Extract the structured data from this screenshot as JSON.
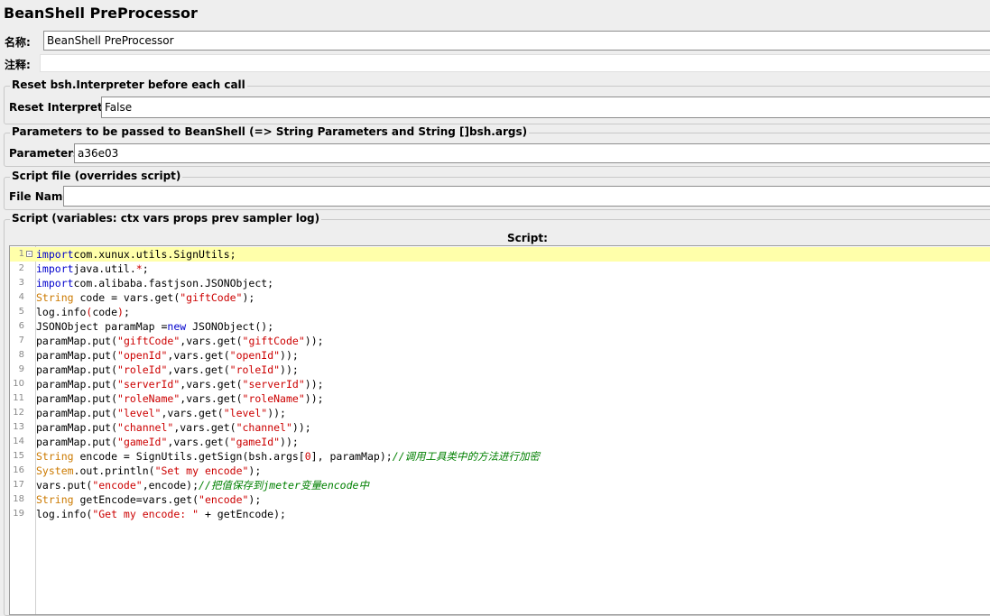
{
  "title": "BeanShell PreProcessor",
  "name": {
    "label": "名称:",
    "value": "BeanShell PreProcessor"
  },
  "comment": {
    "label": "注释:",
    "value": ""
  },
  "reset_group": {
    "legend": "Reset bsh.Interpreter before each call",
    "label": "Reset Interpreter:",
    "value": "False"
  },
  "params_group": {
    "legend": "Parameters to be passed to BeanShell (=> String Parameters and String []bsh.args)",
    "label": "Parameters:",
    "value": "a36e03"
  },
  "file_group": {
    "legend": "Script file (overrides script)",
    "label": "File Name:",
    "value": ""
  },
  "script_group": {
    "legend": "Script (variables: ctx vars props prev sampler log)",
    "label": "Script:"
  },
  "colors": {
    "keyword": "#0000cc",
    "type": "#cc7a00",
    "string": "#cc0000",
    "comment": "#008000",
    "current_line": "#ffffaa"
  },
  "script_lines": [
    {
      "n": "1",
      "tokens": [
        [
          "kw",
          "import"
        ],
        [
          "",
          "com.xunux.utils.SignUtils;"
        ]
      ]
    },
    {
      "n": "2",
      "tokens": [
        [
          "kw",
          "import"
        ],
        [
          "",
          "java.util."
        ],
        [
          "pn",
          "*"
        ],
        [
          "",
          ";"
        ]
      ]
    },
    {
      "n": "3",
      "tokens": [
        [
          "kw",
          "import"
        ],
        [
          "",
          "com.alibaba.fastjson.JSONObject;"
        ]
      ]
    },
    {
      "n": "4",
      "tokens": [
        [
          "ty",
          "String"
        ],
        [
          "",
          " code = vars.get("
        ],
        [
          "st",
          "\"giftCode\""
        ],
        [
          "",
          ");"
        ]
      ]
    },
    {
      "n": "5",
      "tokens": [
        [
          "",
          "log.info"
        ],
        [
          "pn",
          "("
        ],
        [
          "",
          "code"
        ],
        [
          "pn",
          ")"
        ],
        [
          "",
          ";"
        ]
      ]
    },
    {
      "n": "6",
      "tokens": [
        [
          "",
          "JSONObject paramMap ="
        ],
        [
          "kw",
          "new"
        ],
        [
          "",
          " JSONObject();"
        ]
      ]
    },
    {
      "n": "7",
      "tokens": [
        [
          "",
          "paramMap.put("
        ],
        [
          "st",
          "\"giftCode\""
        ],
        [
          "",
          ",vars.get("
        ],
        [
          "st",
          "\"giftCode\""
        ],
        [
          "",
          "));"
        ]
      ]
    },
    {
      "n": "8",
      "tokens": [
        [
          "",
          "paramMap.put("
        ],
        [
          "st",
          "\"openId\""
        ],
        [
          "",
          ",vars.get("
        ],
        [
          "st",
          "\"openId\""
        ],
        [
          "",
          "));"
        ]
      ]
    },
    {
      "n": "9",
      "tokens": [
        [
          "",
          "paramMap.put("
        ],
        [
          "st",
          "\"roleId\""
        ],
        [
          "",
          ",vars.get("
        ],
        [
          "st",
          "\"roleId\""
        ],
        [
          "",
          "));"
        ]
      ]
    },
    {
      "n": "10",
      "tokens": [
        [
          "",
          "paramMap.put("
        ],
        [
          "st",
          "\"serverId\""
        ],
        [
          "",
          ",vars.get("
        ],
        [
          "st",
          "\"serverId\""
        ],
        [
          "",
          "));"
        ]
      ]
    },
    {
      "n": "11",
      "tokens": [
        [
          "",
          "paramMap.put("
        ],
        [
          "st",
          "\"roleName\""
        ],
        [
          "",
          ",vars.get("
        ],
        [
          "st",
          "\"roleName\""
        ],
        [
          "",
          "));"
        ]
      ]
    },
    {
      "n": "12",
      "tokens": [
        [
          "",
          "paramMap.put("
        ],
        [
          "st",
          "\"level\""
        ],
        [
          "",
          ",vars.get("
        ],
        [
          "st",
          "\"level\""
        ],
        [
          "",
          "));"
        ]
      ]
    },
    {
      "n": "13",
      "tokens": [
        [
          "",
          "paramMap.put("
        ],
        [
          "st",
          "\"channel\""
        ],
        [
          "",
          ",vars.get("
        ],
        [
          "st",
          "\"channel\""
        ],
        [
          "",
          "));"
        ]
      ]
    },
    {
      "n": "14",
      "tokens": [
        [
          "",
          "paramMap.put("
        ],
        [
          "st",
          "\"gameId\""
        ],
        [
          "",
          ",vars.get("
        ],
        [
          "st",
          "\"gameId\""
        ],
        [
          "",
          "));"
        ]
      ]
    },
    {
      "n": "15",
      "tokens": [
        [
          "ty",
          "String"
        ],
        [
          "",
          " encode = SignUtils.getSign(bsh.args["
        ],
        [
          "st",
          "0"
        ],
        [
          "",
          "], paramMap);"
        ],
        [
          "cm",
          "//调用工具类中的方法进行加密"
        ]
      ]
    },
    {
      "n": "16",
      "tokens": [
        [
          "ty",
          "System"
        ],
        [
          "",
          ".out.println("
        ],
        [
          "st",
          "\"Set my encode\""
        ],
        [
          "",
          ");"
        ]
      ]
    },
    {
      "n": "17",
      "tokens": [
        [
          "",
          "vars.put("
        ],
        [
          "st",
          "\"encode\""
        ],
        [
          "",
          ",encode);"
        ],
        [
          "cm",
          "//把值保存到jmeter变量encode中"
        ]
      ]
    },
    {
      "n": "18",
      "tokens": [
        [
          "ty",
          "String"
        ],
        [
          "",
          " getEncode=vars.get("
        ],
        [
          "st",
          "\"encode\""
        ],
        [
          "",
          ");"
        ]
      ]
    },
    {
      "n": "19",
      "tokens": [
        [
          "",
          "log.info("
        ],
        [
          "st",
          "\"Get my encode: \""
        ],
        [
          "",
          " + getEncode);"
        ]
      ]
    }
  ]
}
